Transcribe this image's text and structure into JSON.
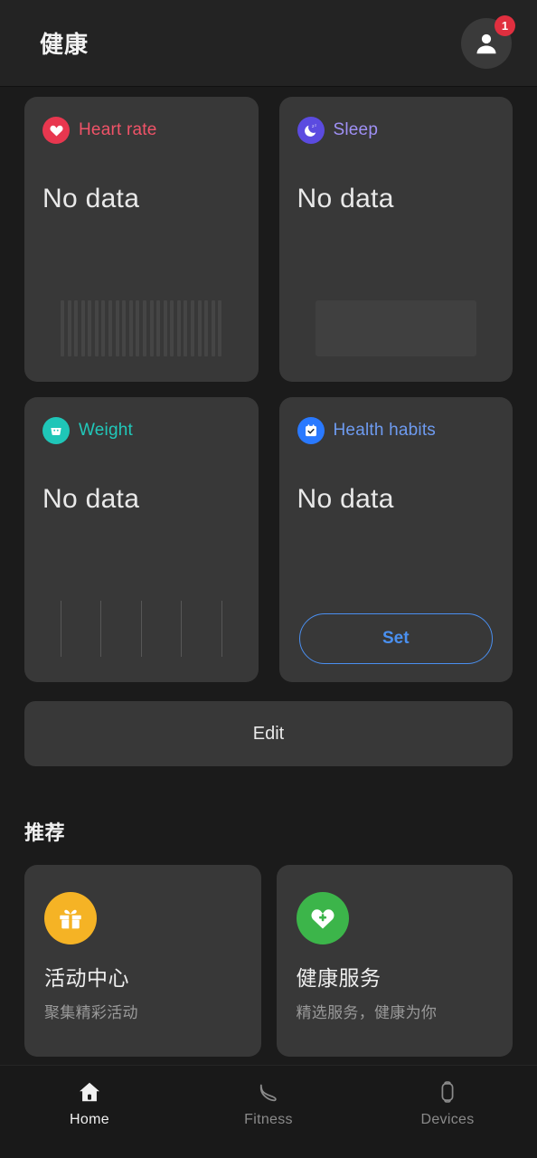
{
  "header": {
    "title": "健康",
    "avatar_icon": "person-icon",
    "badge_count": "1"
  },
  "metrics": {
    "cards": [
      {
        "id": "heart-rate",
        "title": "Heart rate",
        "title_color": "#f05368",
        "icon": "heart-icon",
        "icon_bg": "#e8374f",
        "value": "No data",
        "placeholder": "bars"
      },
      {
        "id": "sleep",
        "title": "Sleep",
        "title_color": "#9f90f5",
        "icon": "moon-icon",
        "icon_bg": "#5b4be0",
        "value": "No data",
        "placeholder": "block"
      },
      {
        "id": "weight",
        "title": "Weight",
        "title_color": "#21c8ba",
        "icon": "scale-icon",
        "icon_bg": "#1fc6b8",
        "value": "No data",
        "placeholder": "lines"
      },
      {
        "id": "health-habits",
        "title": "Health habits",
        "title_color": "#6e9bf0",
        "icon": "calendar-check-icon",
        "icon_bg": "#2979ff",
        "value": "No data",
        "placeholder": "button",
        "action_label": "Set"
      }
    ],
    "edit_label": "Edit"
  },
  "recommendations": {
    "section_title": "推荐",
    "cards": [
      {
        "id": "activity-center",
        "title": "活动中心",
        "subtitle": "聚集精彩活动",
        "icon": "gift-icon",
        "icon_bg": "#f5b325"
      },
      {
        "id": "health-services",
        "title": "健康服务",
        "subtitle": "精选服务，健康为你",
        "icon": "heart-plus-icon",
        "icon_bg": "#3cb54a"
      }
    ]
  },
  "bottom_nav": {
    "items": [
      {
        "id": "home",
        "label": "Home",
        "icon": "home-icon",
        "active": true
      },
      {
        "id": "fitness",
        "label": "Fitness",
        "icon": "shoe-icon",
        "active": false
      },
      {
        "id": "devices",
        "label": "Devices",
        "icon": "watch-icon",
        "active": false
      }
    ]
  }
}
